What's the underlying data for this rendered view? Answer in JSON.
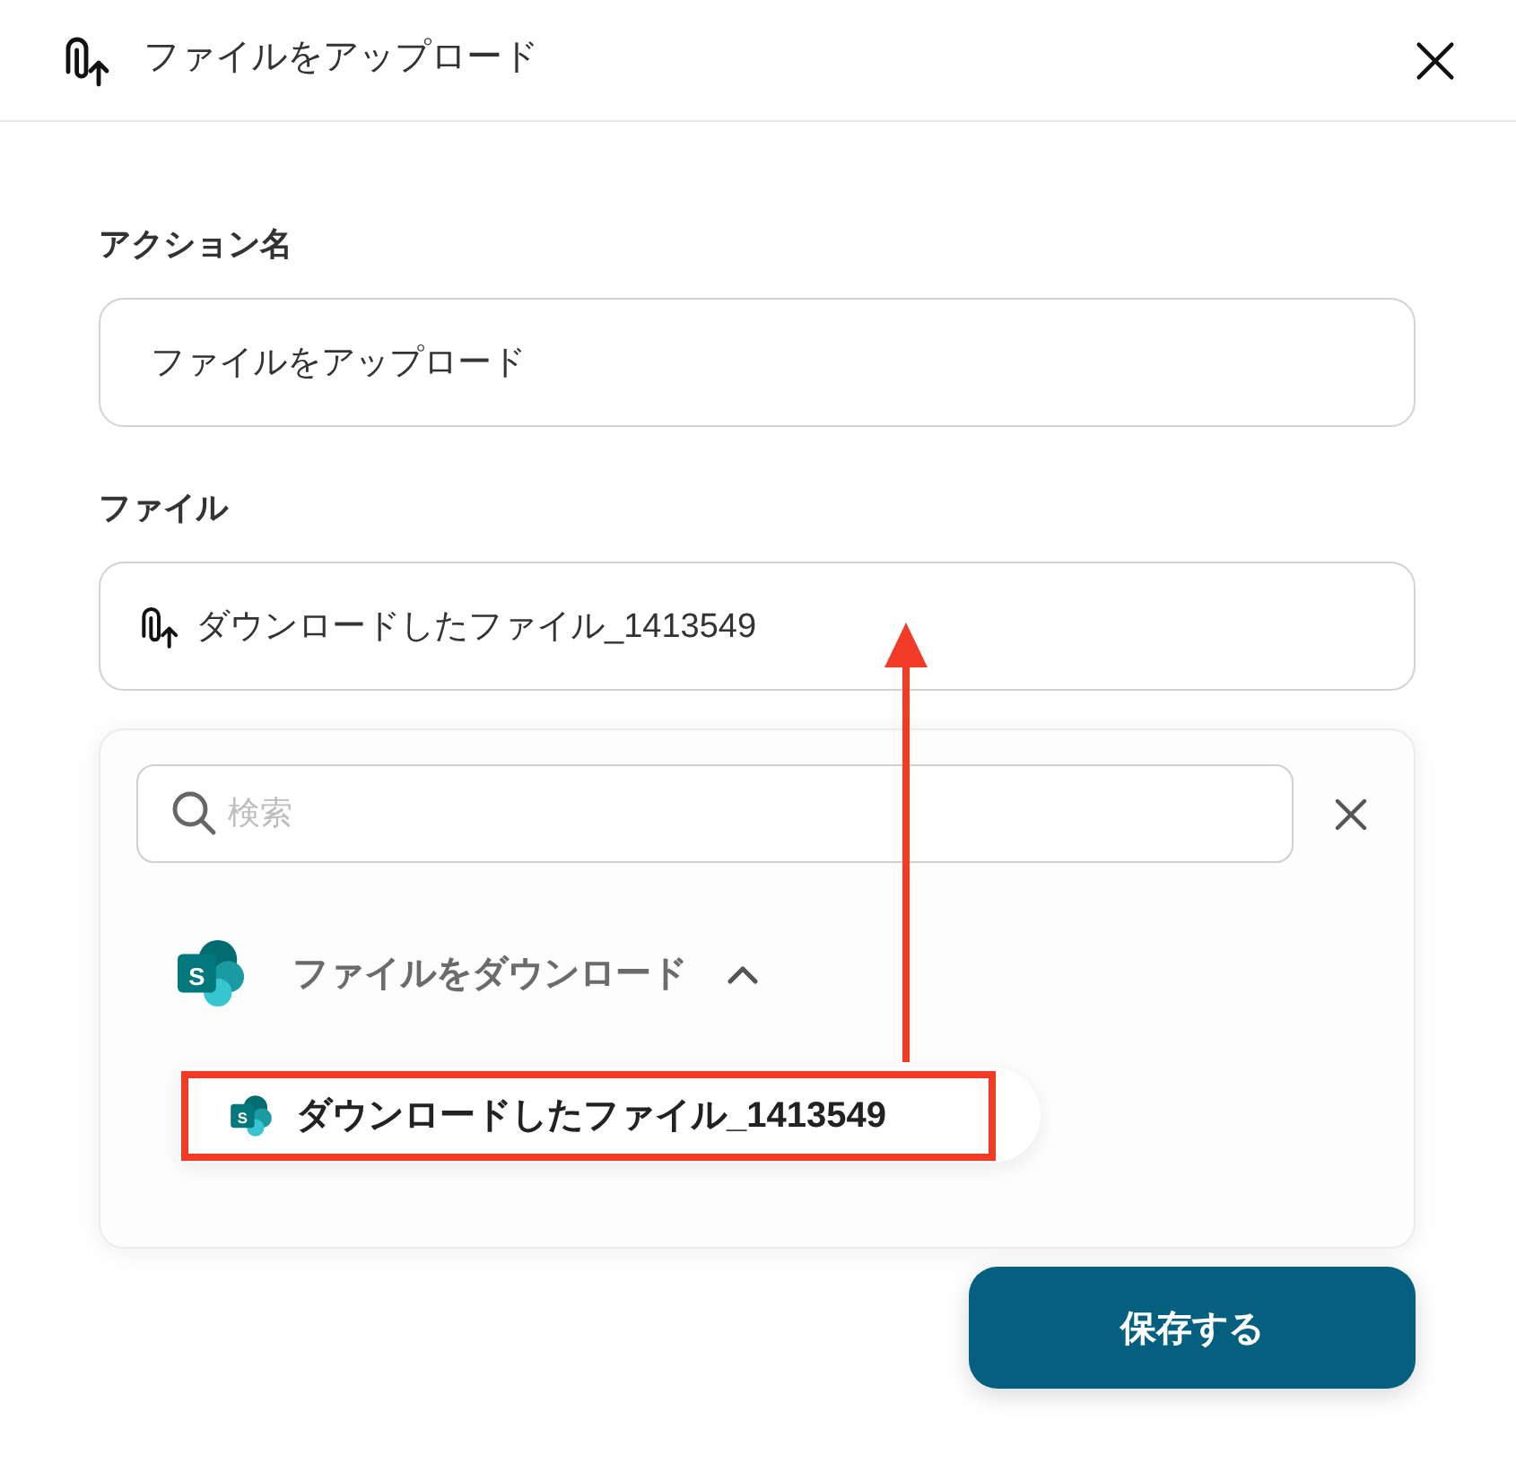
{
  "dialog": {
    "title": "ファイルをアップロード"
  },
  "fields": [
    {
      "kind": "text",
      "label": "アクション名",
      "value": "ファイルをアップロード"
    },
    {
      "kind": "file",
      "label": "ファイル",
      "value": "ダウンロードしたファイル_1413549"
    }
  ],
  "picker": {
    "search": {
      "placeholder": "検索"
    },
    "groups": [
      {
        "icon_text": "S",
        "label": "ファイルをダウンロード",
        "expanded": true,
        "items": [
          {
            "icon_text": "S",
            "label": "ダウンロードしたファイル_1413549",
            "highlighted": true
          }
        ]
      }
    ]
  },
  "buttons": [
    {
      "label": "保存する"
    }
  ]
}
